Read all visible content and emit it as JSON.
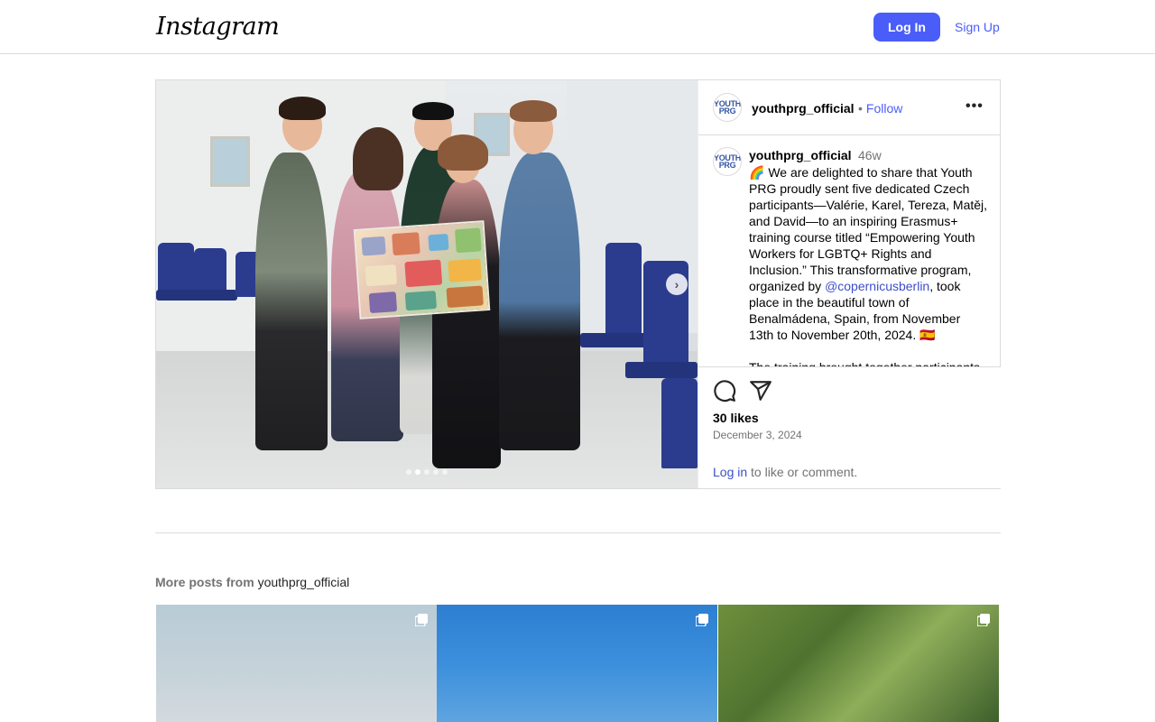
{
  "header": {
    "logo_text": "Instagram",
    "login_label": "Log In",
    "signup_label": "Sign Up"
  },
  "post": {
    "username": "youthprg_official",
    "follow_label": "Follow",
    "follow_separator": "•",
    "more_options": "•••",
    "avatar_text": "YOUTH PRG",
    "carousel": {
      "dot_count": 5,
      "active_index": 1
    },
    "caption": {
      "username": "youthprg_official",
      "time": "46w",
      "text_part1": "🌈 We are delighted to share that Youth PRG proudly sent five dedicated Czech participants—Valérie, Karel, Tereza, Matěj, and David—to an inspiring Erasmus+ training course titled “Empowering Youth Workers for LGBTQ+ Rights and Inclusion.” This transformative program, organized by ",
      "mention": "@copernicusberlin",
      "text_part2": ", took place in the beautiful town of Benalmádena, Spain, from November 13th to November 20th, 2024. 🇪🇸",
      "text_more": "The training brought together participants"
    },
    "likes": "30 likes",
    "date": "December 3, 2024",
    "login_prompt": {
      "link": "Log in",
      "rest": " to like or comment."
    }
  },
  "more_posts": {
    "label": "More posts from ",
    "username": "youthprg_official"
  },
  "colors": {
    "accent": "#4a5df9",
    "border": "#dbdbdb",
    "muted": "#737373"
  }
}
